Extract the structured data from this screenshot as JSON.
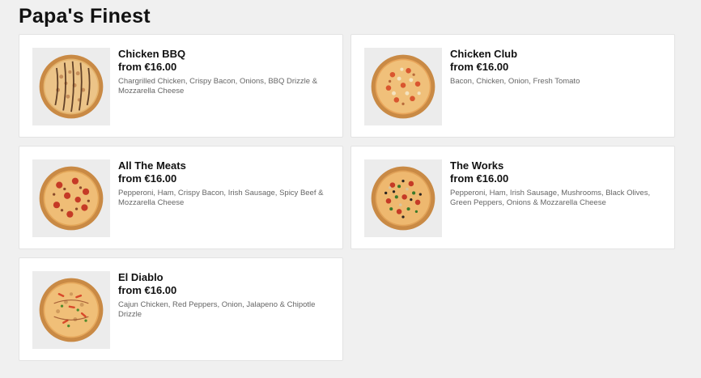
{
  "section": {
    "title": "Papa's Finest"
  },
  "products": [
    {
      "name": "Chicken BBQ",
      "price": "from €16.00",
      "description": "Chargrilled Chicken, Crispy Bacon, Onions, BBQ Drizzle & Mozzarella Cheese",
      "image_icon": "pizza-chicken-bbq-image"
    },
    {
      "name": "Chicken Club",
      "price": "from €16.00",
      "description": "Bacon, Chicken, Onion, Fresh Tomato",
      "image_icon": "pizza-chicken-club-image"
    },
    {
      "name": "All The Meats",
      "price": "from €16.00",
      "description": "Pepperoni, Ham, Crispy Bacon, Irish Sausage, Spicy Beef & Mozzarella Cheese",
      "image_icon": "pizza-all-the-meats-image"
    },
    {
      "name": "The Works",
      "price": "from €16.00",
      "description": "Pepperoni, Ham, Irish Sausage, Mushrooms, Black Olives, Green Peppers, Onions & Mozzarella Cheese",
      "image_icon": "pizza-the-works-image"
    },
    {
      "name": "El Diablo",
      "price": "from €16.00",
      "description": "Cajun Chicken, Red Peppers, Onion, Jalapeno & Chipotle Drizzle",
      "image_icon": "pizza-el-diablo-image"
    }
  ],
  "colors": {
    "page_background": "#f0f0f0",
    "card_background": "#ffffff",
    "thumb_background": "#ececec",
    "crust": "#d9a35c",
    "cheese": "#f2c77a"
  }
}
